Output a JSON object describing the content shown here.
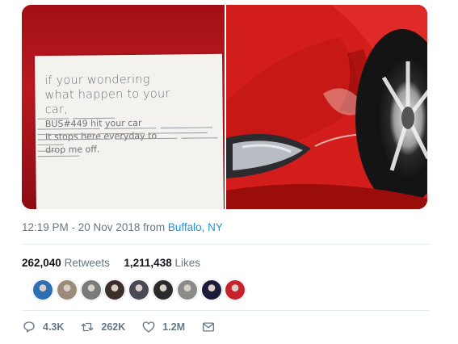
{
  "note": {
    "line1": "if your wondering",
    "line2": "what happen to your",
    "line3": "car,",
    "line4": "BUS#449 hit your car",
    "line5": "It stops here everyday to",
    "line6": "drop me off."
  },
  "tweet_meta": {
    "time": "12:19 PM - 20 Nov 2018",
    "from": "from",
    "location": "Buffalo, NY"
  },
  "stats": {
    "retweets_count": "262,040",
    "retweets_label": "Retweets",
    "likes_count": "1,211,438",
    "likes_label": "Likes"
  },
  "avatars": [
    "#2d6fb3",
    "#9c8a7a",
    "#7a7a7a",
    "#3c2f2a",
    "#4a4a55",
    "#2a2a2a",
    "#8a8a88",
    "#1c1c3a",
    "#c8232c"
  ],
  "actions": {
    "reply_count": "4.3K",
    "retweet_count": "262K",
    "like_count": "1.2M"
  },
  "icons": {
    "reply": "reply-icon",
    "retweet": "retweet-icon",
    "like": "heart-icon",
    "dm": "envelope-icon"
  }
}
